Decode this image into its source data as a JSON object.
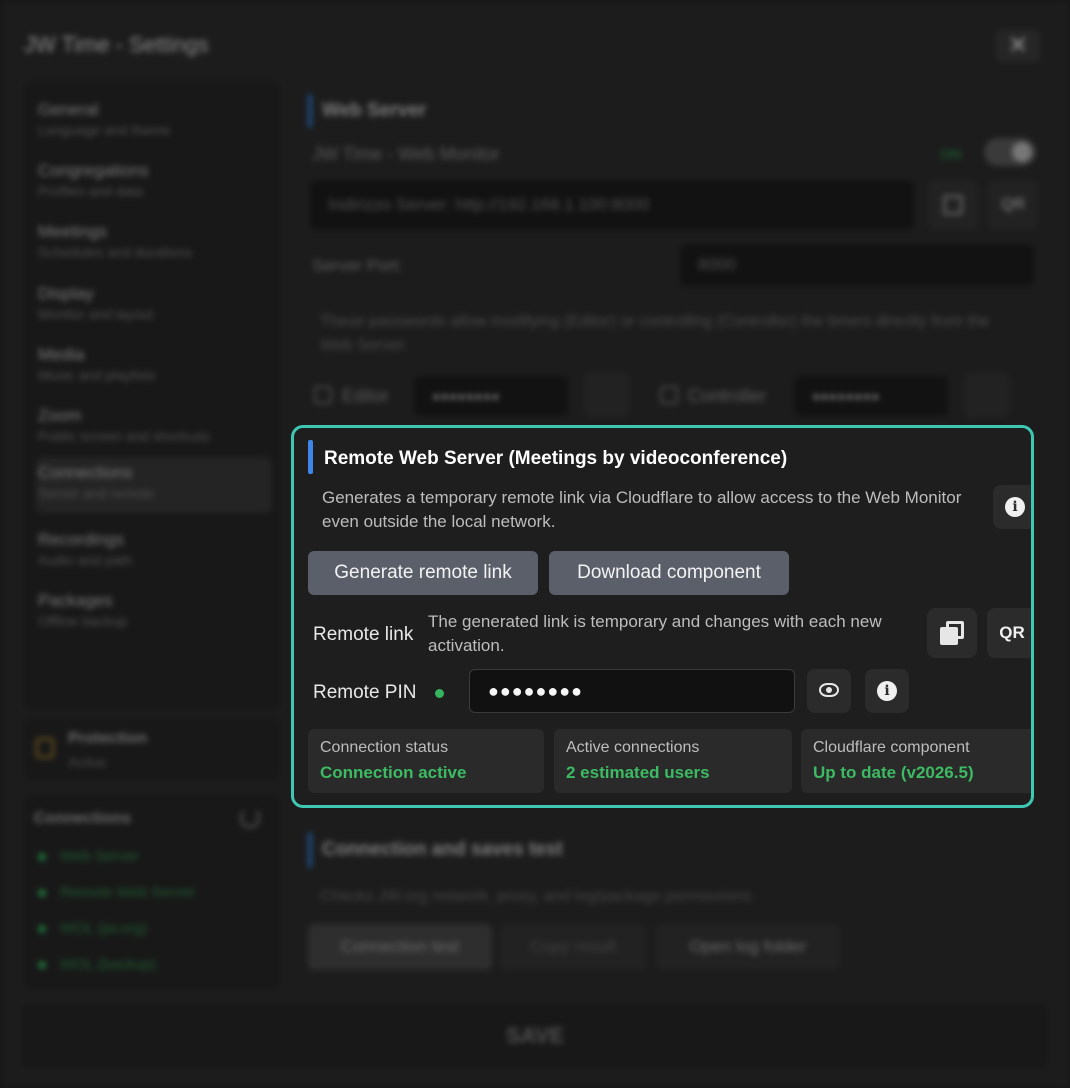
{
  "window": {
    "title": "JW Time - Settings",
    "close_glyph": "✕"
  },
  "sidebar": {
    "items": [
      {
        "title": "General",
        "subtitle": "Language and theme"
      },
      {
        "title": "Congregations",
        "subtitle": "Profiles and data"
      },
      {
        "title": "Meetings",
        "subtitle": "Schedules and durations"
      },
      {
        "title": "Display",
        "subtitle": "Monitor and layout"
      },
      {
        "title": "Media",
        "subtitle": "Music and playlists"
      },
      {
        "title": "Zoom",
        "subtitle": "Public screen and shortcuts"
      },
      {
        "title": "Connections",
        "subtitle": "Server and remote"
      },
      {
        "title": "Recordings",
        "subtitle": "Audio and path"
      },
      {
        "title": "Packages",
        "subtitle": "Offline backup"
      }
    ],
    "active_index": 6
  },
  "protection": {
    "title": "Protection",
    "status": "Active"
  },
  "connections_widget": {
    "title": "Connections",
    "items": [
      "Web Server",
      "Remote Web Server",
      "WOL (jw.org)",
      "WOL (backup)"
    ]
  },
  "web_server": {
    "title": "Web Server",
    "monitor_label": "JW Time - Web Monitor",
    "toggle_state": "ON",
    "address": "Indirizzo Server: http://192.168.1.100:8000",
    "qr_label": "QR",
    "port_label": "Server Port:",
    "port_value": "8000",
    "passwords_note": "These passwords allow modifying (Editor) or controlling (Controller) the timers directly from the Web Server.",
    "editor_label": "Editor",
    "editor_value": "●●●●●●●●",
    "controller_label": "Controller",
    "controller_value": "●●●●●●●●"
  },
  "remote": {
    "title": "Remote Web Server (Meetings by videoconference)",
    "description": "Generates a temporary remote link via Cloudflare to allow access to the Web Monitor even outside the local network.",
    "generate_label": "Generate remote link",
    "download_label": "Download component",
    "link_label": "Remote link",
    "link_hint": "The generated link is temporary and changes with each new activation.",
    "qr_label": "QR",
    "pin_label": "Remote PIN",
    "pin_value": "●●●●●●●●",
    "info_glyph": "i",
    "status_color": "#3dbb63",
    "stats": [
      {
        "label": "Connection status",
        "value": "Connection active"
      },
      {
        "label": "Active connections",
        "value": "2 estimated users"
      },
      {
        "label": "Cloudflare component",
        "value": "Up to date (v2026.5)"
      }
    ]
  },
  "test": {
    "title": "Connection and saves test",
    "description": "Checks JW.org network, proxy, and log/package permissions.",
    "run_label": "Connection test",
    "copy_label": "Copy result",
    "log_label": "Open log folder"
  },
  "save_label": "SAVE"
}
